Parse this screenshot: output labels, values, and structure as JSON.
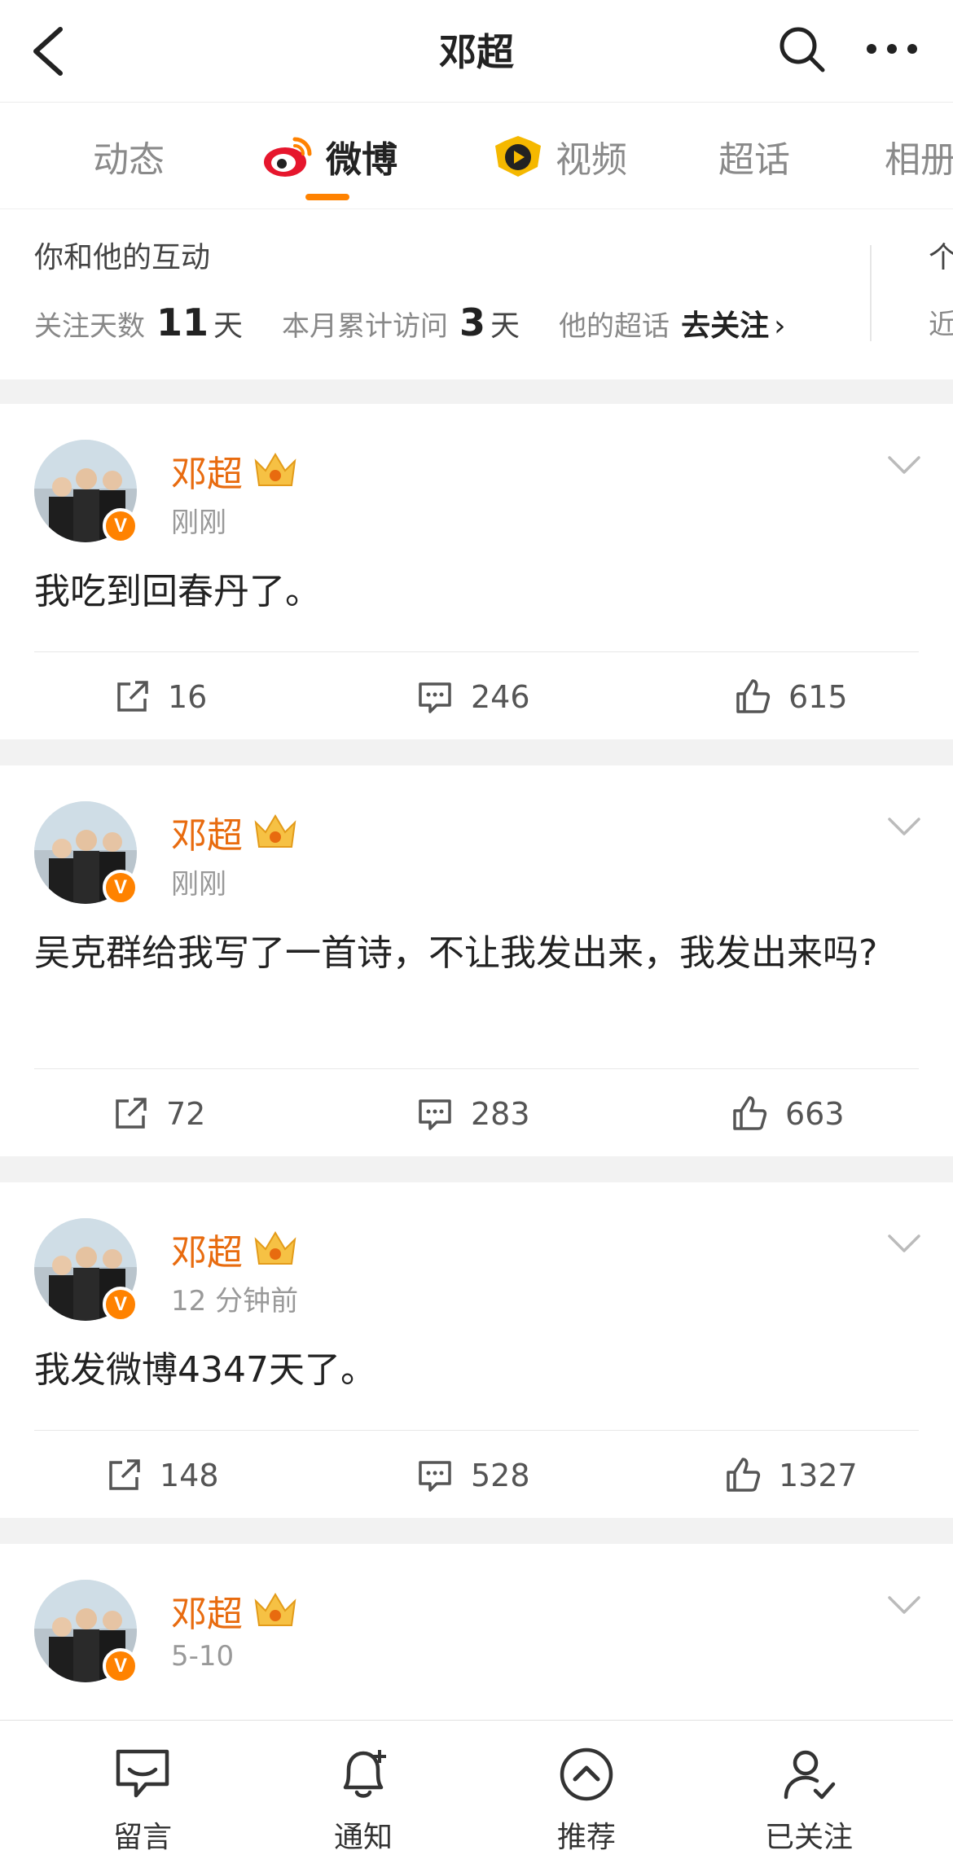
{
  "header": {
    "title": "邓超"
  },
  "tabs": [
    {
      "label": "动态"
    },
    {
      "label": "微博"
    },
    {
      "label": "视频"
    },
    {
      "label": "超话"
    },
    {
      "label": "相册"
    }
  ],
  "interaction": {
    "heading": "你和他的互动",
    "follow_days_label": "关注天数",
    "follow_days": "11",
    "day_unit": "天",
    "monthly_visits_label": "本月累计访问",
    "monthly_visits": "3",
    "supertopic_label": "他的超话",
    "supertopic_action": "去关注",
    "chevron": "›",
    "cut_heading": "个",
    "cut_sub": "近"
  },
  "posts": [
    {
      "author": "邓超",
      "time": "刚刚",
      "text": "我吃到回春丹了。",
      "reposts": "16",
      "comments": "246",
      "likes": "615"
    },
    {
      "author": "邓超",
      "time": "刚刚",
      "text": "吴克群给我写了一首诗，不让我发出来，我发出来吗?",
      "reposts": "72",
      "comments": "283",
      "likes": "663"
    },
    {
      "author": "邓超",
      "time": "12 分钟前",
      "text": "我发微博4347天了。",
      "reposts": "148",
      "comments": "528",
      "likes": "1327"
    },
    {
      "author": "邓超",
      "time": "5-10"
    }
  ],
  "verified_badge": "V",
  "bottom_nav": [
    {
      "label": "留言",
      "icon": "message-icon"
    },
    {
      "label": "通知",
      "icon": "bell-icon"
    },
    {
      "label": "推荐",
      "icon": "recommend-icon"
    },
    {
      "label": "已关注",
      "icon": "followed-user-icon"
    }
  ],
  "colors": {
    "accent": "#ff8200",
    "author": "#e86b0f"
  }
}
